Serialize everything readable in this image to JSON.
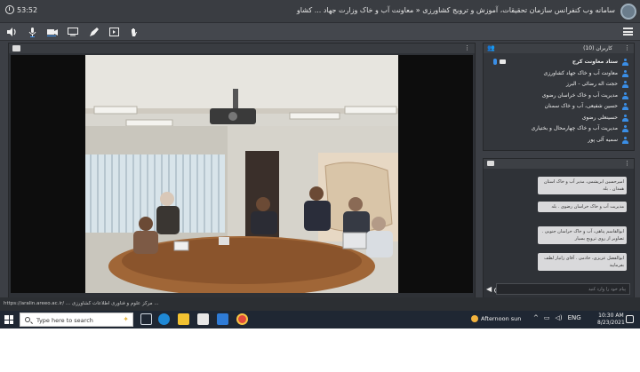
{
  "window": {
    "title": "سامانه وب کنفرانس سازمان تحقیقات، آموزش و ترویج کشاورزی « معاونت آب و خاک وزارت جهاد ... کشاو",
    "timer": "53:52"
  },
  "toolbar": {
    "icons": [
      "speaker-icon",
      "microphone-icon",
      "camera-icon",
      "screen-share-icon",
      "pen-icon",
      "present-icon",
      "raise-hand-icon",
      "menu-icon"
    ]
  },
  "attendees": {
    "header": "کاربران (10)",
    "items": [
      {
        "name": "ستاد معاونت کرج",
        "mic": true,
        "cam": true
      },
      {
        "name": "معاونت آب و خاک جهاد کشاورزی",
        "mic": false,
        "cam": false
      },
      {
        "name": "حجت اله رضائی - البرز",
        "mic": false,
        "cam": false
      },
      {
        "name": "مدیریت آب و خاک خراسان رضوی",
        "mic": false,
        "cam": false
      },
      {
        "name": "حسین شفیعی، آب و خاک سمنان",
        "mic": false,
        "cam": false
      },
      {
        "name": "حسینعلی رضوی",
        "mic": false,
        "cam": false
      },
      {
        "name": "مدیریت آب و خاک چهارمحال و بختیاری",
        "mic": false,
        "cam": false
      },
      {
        "name": "سمیه آلی پور",
        "mic": false,
        "cam": false
      }
    ]
  },
  "chat": {
    "messages": [
      "امیرحسین ابریشمی، مدیر آب و خاک استان همدان . بله",
      "مدیریت آب و خاک خراسان رضوی . بله",
      "ابوالقاسم پناهی، آب و خاک خراسان جنوبی . تصاویر از روی ترویج بسیار",
      "ابوالفضل عزیزی، خادمی . آقای زانیار لطف بفرمایید"
    ],
    "input_placeholder": "پیام خود را وارد کنید"
  },
  "status": {
    "url": "https://aralin.areeo.ac.ir/ ... مرکز علوم و فناوری اطلاعات کشاورزی ..."
  },
  "taskbar": {
    "search_placeholder": "Type here to search",
    "weather": "Afternoon sun",
    "lang": "ENG",
    "time": "10:30 AM",
    "date": "8/23/2021"
  },
  "colors": {
    "accent": "#3a8ee6",
    "panel": "#3c3f45",
    "taskbar": "#1f2733"
  }
}
